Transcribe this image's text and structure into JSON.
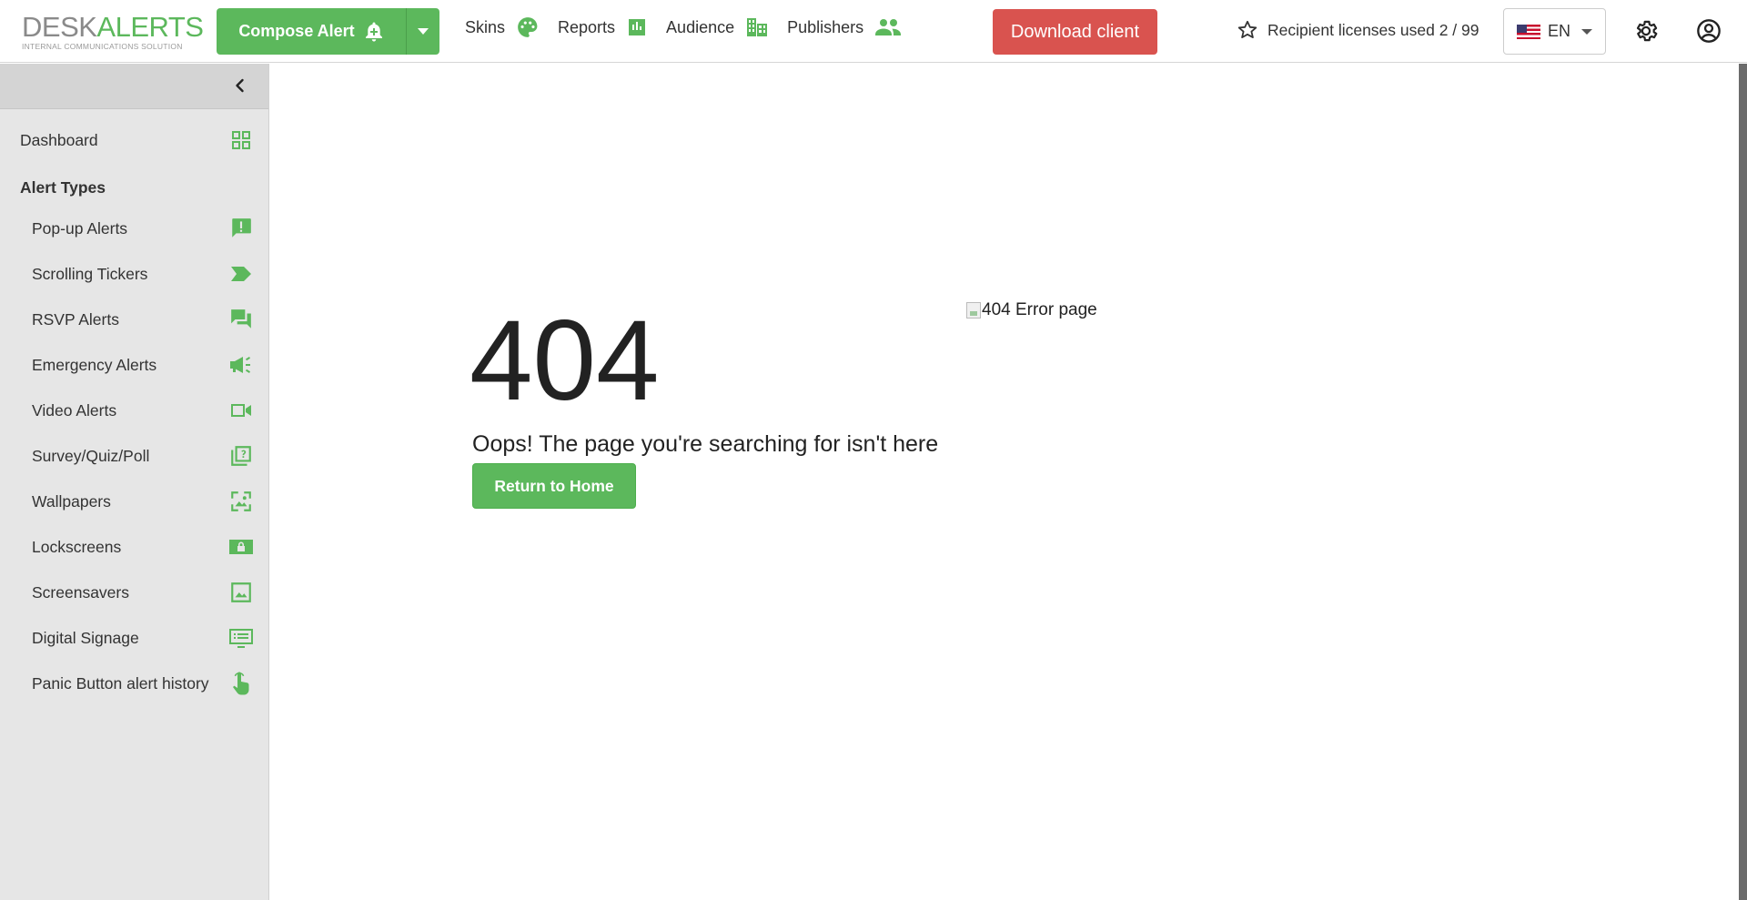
{
  "brand": {
    "desk": "DESK",
    "alerts": "ALERTS",
    "subtitle": "INTERNAL COMMUNICATIONS SOLUTION",
    "accent_color": "#5cb85c"
  },
  "header": {
    "compose_label": "Compose Alert",
    "nav": [
      {
        "label": "Skins",
        "icon": "palette-icon"
      },
      {
        "label": "Reports",
        "icon": "bar-chart-icon"
      },
      {
        "label": "Audience",
        "icon": "audience-icon"
      },
      {
        "label": "Publishers",
        "icon": "people-icon"
      }
    ],
    "download_label": "Download client",
    "download_color": "#d9534f",
    "licenses_text": "Recipient licenses used 2 / 99",
    "language": "EN"
  },
  "sidebar": {
    "dashboard_label": "Dashboard",
    "alert_types_heading": "Alert Types",
    "items": [
      {
        "label": "Pop-up Alerts",
        "icon": "exclamation-message-icon"
      },
      {
        "label": "Scrolling Tickers",
        "icon": "ticker-tag-icon"
      },
      {
        "label": "RSVP Alerts",
        "icon": "chat-bubbles-icon"
      },
      {
        "label": "Emergency Alerts",
        "icon": "megaphone-icon"
      },
      {
        "label": "Video Alerts",
        "icon": "video-camera-icon"
      },
      {
        "label": "Survey/Quiz/Poll",
        "icon": "question-pages-icon"
      },
      {
        "label": "Wallpapers",
        "icon": "wallpaper-icon"
      },
      {
        "label": "Lockscreens",
        "icon": "lock-screen-icon"
      },
      {
        "label": "Screensavers",
        "icon": "image-icon"
      },
      {
        "label": "Digital Signage",
        "icon": "signage-screen-icon"
      },
      {
        "label": "Panic Button alert history",
        "icon": "touch-hand-icon"
      }
    ]
  },
  "main": {
    "error_code": "404",
    "error_message": "Oops! The page you're searching for isn't here",
    "return_home_label": "Return to Home",
    "image_alt": "404 Error page"
  }
}
